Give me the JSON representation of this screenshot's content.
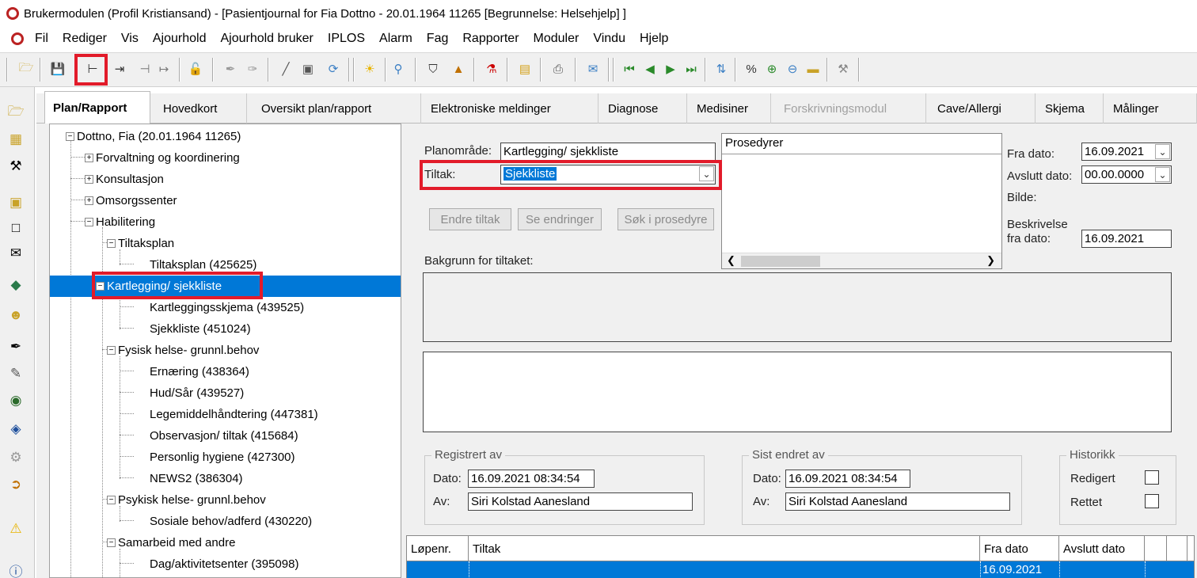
{
  "window": {
    "title": "Brukermodulen (Profil Kristiansand) - [Pasientjournal for Fia Dottno - 20.01.1964 11265  [Begrunnelse: Helsehjelp] ]"
  },
  "menu": [
    "Fil",
    "Rediger",
    "Vis",
    "Ajourhold",
    "Ajourhold bruker",
    "IPLOS",
    "Alarm",
    "Fag",
    "Rapporter",
    "Moduler",
    "Vindu",
    "Hjelp"
  ],
  "tabs": [
    {
      "label": "Plan/Rapport",
      "active": true
    },
    {
      "label": "Hovedkort"
    },
    {
      "label": "Oversikt plan/rapport"
    },
    {
      "label": "Elektroniske meldinger"
    },
    {
      "label": "Diagnose"
    },
    {
      "label": "Medisiner"
    },
    {
      "label": "Forskrivningsmodul",
      "disabled": true
    },
    {
      "label": "Cave/Allergi"
    },
    {
      "label": "Skjema"
    },
    {
      "label": "Målinger"
    }
  ],
  "tree": {
    "root": "Dottno, Fia (20.01.1964 11265)",
    "n_forvaltning": "Forvaltning og koordinering",
    "n_konsultasjon": "Konsultasjon",
    "n_omsorgssenter": "Omsorgssenter",
    "n_habilitering": "Habilitering",
    "n_tiltaksplan": "Tiltaksplan",
    "n_tiltaksplan_item": "Tiltaksplan (425625)",
    "n_kartlegging": "Kartlegging/ sjekkliste",
    "n_kartleggingsskjema": "Kartleggingsskjema (439525)",
    "n_sjekkliste": "Sjekkliste (451024)",
    "n_fysisk": "Fysisk helse- grunnl.behov",
    "n_ernaering": "Ernæring (438364)",
    "n_hud": "Hud/Sår (439527)",
    "n_legemiddel": "Legemiddelhåndtering (447381)",
    "n_observasjon": "Observasjon/ tiltak (415684)",
    "n_hygiene": "Personlig hygiene (427300)",
    "n_news2": "NEWS2 (386304)",
    "n_psykisk": "Psykisk helse- grunnl.behov",
    "n_sosiale": "Sosiale behov/adferd (430220)",
    "n_samarbeid": "Samarbeid med andre",
    "n_dag": "Dag/aktivitetsenter (395098)"
  },
  "form": {
    "planomrade_label": "Planområde:",
    "planomrade_value": "Kartlegging/ sjekkliste",
    "tiltak_label": "Tiltak:",
    "tiltak_value": "Sjekkliste",
    "btn_endre": "Endre tiltak",
    "btn_se_endringer": "Se endringer",
    "btn_sok": "Søk i prosedyre",
    "prosedyrer_header": "Prosedyrer",
    "bakgrunn_label": "Bakgrunn for tiltaket:",
    "fra_dato_label": "Fra dato:",
    "fra_dato_value": "16.09.2021",
    "avslutt_label": "Avslutt dato:",
    "avslutt_value": "00.00.0000",
    "bilde_label": "Bilde:",
    "beskrivelse_label1": "Beskrivelse",
    "beskrivelse_label2": "fra dato:",
    "beskrivelse_value": "16.09.2021"
  },
  "registrert": {
    "title": "Registrert av",
    "dato_label": "Dato:",
    "dato_value": "16.09.2021  08:34:54",
    "av_label": "Av:",
    "av_value": "Siri Kolstad Aanesland"
  },
  "sist_endret": {
    "title": "Sist endret av",
    "dato_label": "Dato:",
    "dato_value": "16.09.2021  08:34:54",
    "av_label": "Av:",
    "av_value": "Siri Kolstad Aanesland"
  },
  "historikk": {
    "title": "Historikk",
    "redigert_label": "Redigert",
    "rettet_label": "Rettet"
  },
  "grid": {
    "columns": [
      "Løpenr.",
      "Tiltak",
      "Fra dato",
      "Avslutt dato"
    ],
    "row": {
      "fra_dato": "16.09.2021"
    }
  },
  "colors": {
    "selection": "#0078d7",
    "highlight": "#e21b2a"
  }
}
